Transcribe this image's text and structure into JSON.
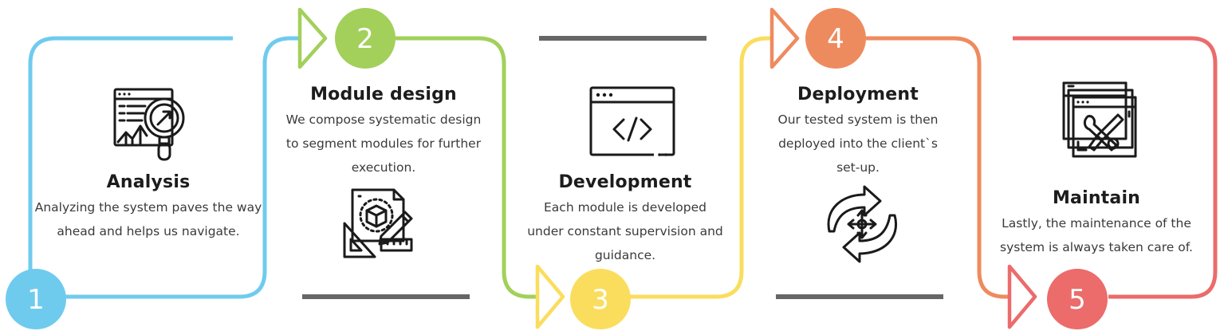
{
  "steps": [
    {
      "number": "1",
      "title": "Analysis",
      "desc": [
        "Analyzing the system paves the way",
        "ahead and helps us navigate."
      ],
      "color": "#6fcbee",
      "icon": "analysis-magnifier-icon"
    },
    {
      "number": "2",
      "title": "Module design",
      "desc": [
        "We compose systematic design",
        "to segment modules for further",
        "execution."
      ],
      "color": "#a2d05a",
      "icon": "design-tools-icon"
    },
    {
      "number": "3",
      "title": "Development",
      "desc": [
        "Each module is developed",
        "under constant supervision and",
        "guidance."
      ],
      "color": "#fbdd5e",
      "icon": "code-window-icon"
    },
    {
      "number": "4",
      "title": "Deployment",
      "desc": [
        "Our tested system is then",
        "deployed into the client`s",
        "set-up."
      ],
      "color": "#ee8b5e",
      "icon": "deploy-arrows-icon"
    },
    {
      "number": "5",
      "title": "Maintain",
      "desc": [
        "Lastly, the maintenance of the",
        "system is always taken care of."
      ],
      "color": "#ec6b6b",
      "icon": "maintenance-tools-icon"
    }
  ],
  "divider_color": "#666666"
}
